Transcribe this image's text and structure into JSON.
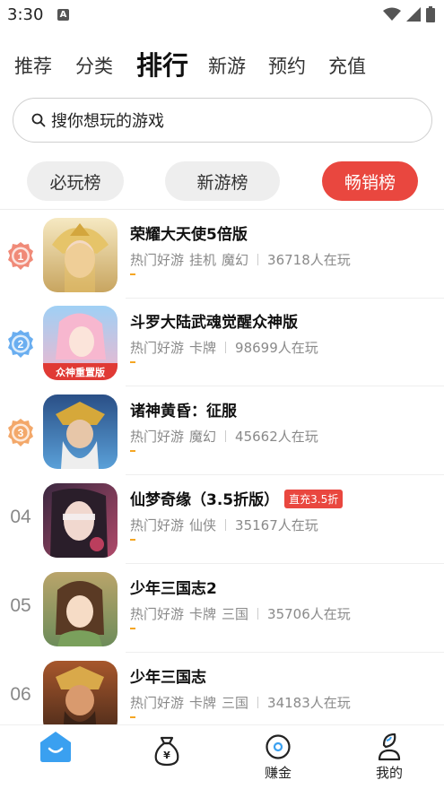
{
  "status_bar": {
    "time": "3:30",
    "notification_glyph": "A"
  },
  "top_tabs": [
    {
      "label": "推荐"
    },
    {
      "label": "分类"
    },
    {
      "label": "排行",
      "active": true
    },
    {
      "label": "新游"
    },
    {
      "label": "预约"
    },
    {
      "label": "充值"
    }
  ],
  "search": {
    "placeholder": "搜你想玩的游戏"
  },
  "rank_tabs": [
    {
      "label": "必玩榜"
    },
    {
      "label": "新游榜"
    },
    {
      "label": "畅销榜",
      "active": true
    }
  ],
  "games": [
    {
      "rank": "1",
      "title": "荣耀大天使5倍版",
      "tags": [
        "热门好游",
        "挂机",
        "魔幻"
      ],
      "players": "36718人在玩",
      "icon": "angel-game-icon"
    },
    {
      "rank": "2",
      "title": "斗罗大陆武魂觉醒众神版",
      "tags": [
        "热门好游",
        "卡牌"
      ],
      "players": "98699人在玩",
      "icon": "douluo-game-icon",
      "icon_banner": "众神重置版"
    },
    {
      "rank": "3",
      "title": "诸神黄昏：征服",
      "tags": [
        "热门好游",
        "魔幻"
      ],
      "players": "45662人在玩",
      "icon": "god-game-icon"
    },
    {
      "rank": "04",
      "title": "仙梦奇缘（3.5折版）",
      "badge": "直充3.5折",
      "tags": [
        "热门好游",
        "仙侠"
      ],
      "players": "35167人在玩",
      "icon": "xianmeng-game-icon"
    },
    {
      "rank": "05",
      "title": "少年三国志2",
      "tags": [
        "热门好游",
        "卡牌",
        "三国"
      ],
      "players": "35706人在玩",
      "icon": "sanguo2-game-icon"
    },
    {
      "rank": "06",
      "title": "少年三国志",
      "tags": [
        "热门好游",
        "卡牌",
        "三国"
      ],
      "players": "34183人在玩",
      "icon": "sanguo-game-icon"
    }
  ],
  "bottom_nav": [
    {
      "label": "",
      "icon": "home-icon",
      "active": true
    },
    {
      "label": "",
      "icon": "money-bag-icon"
    },
    {
      "label": "赚金",
      "icon": "coin-icon"
    },
    {
      "label": "我的",
      "icon": "profile-icon"
    }
  ],
  "colors": {
    "accent": "#e9473f",
    "text_primary": "#111111",
    "text_secondary": "#8a8a8a",
    "home_blue": "#3aa0f0",
    "rank_badge_line": "#f5a623"
  }
}
